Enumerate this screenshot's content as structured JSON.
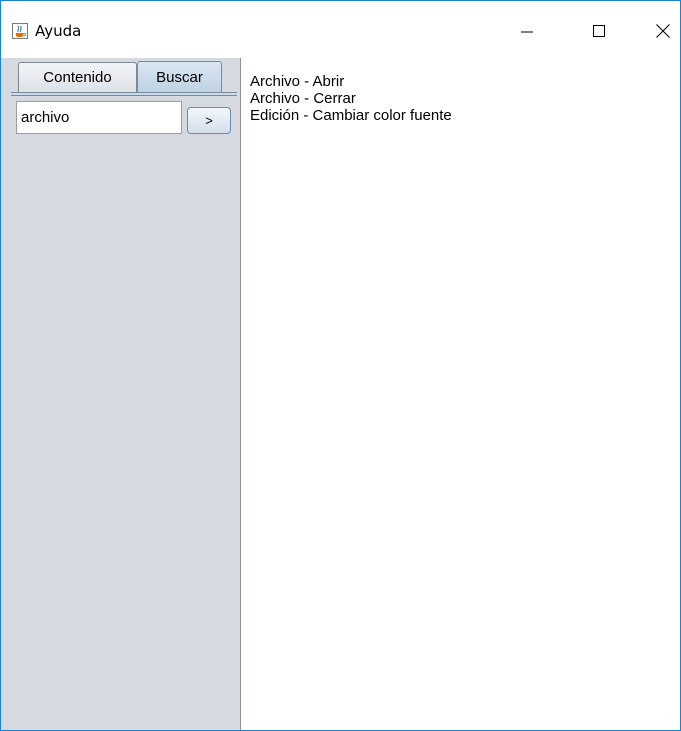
{
  "window": {
    "title": "Ayuda",
    "icons": {
      "app": "java-cup-icon",
      "minimize": "minimize-icon",
      "maximize": "maximize-icon",
      "close": "close-icon"
    }
  },
  "tabs": [
    {
      "label": "Contenido",
      "selected": false
    },
    {
      "label": "Buscar",
      "selected": true
    }
  ],
  "search": {
    "value": "archivo",
    "button_label": ">"
  },
  "results": [
    "Archivo - Abrir",
    "Archivo - Cerrar",
    "Edición - Cambiar color fuente"
  ],
  "colors": {
    "window_border": "#1883d7",
    "left_pane_bg": "#d6d9df",
    "selected_tab_bg": "#bfd3e4"
  }
}
